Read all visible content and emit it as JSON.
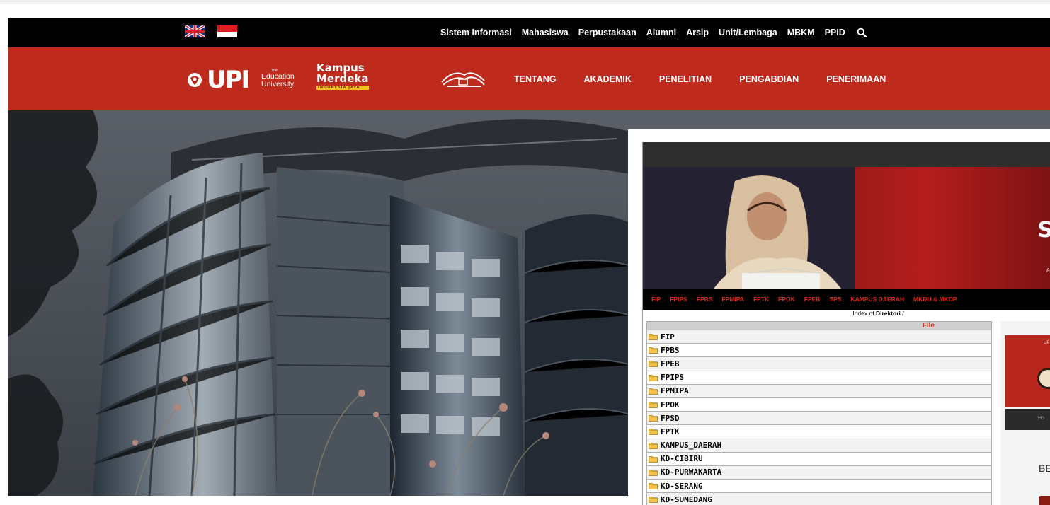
{
  "utility_bar": {
    "flags": [
      {
        "name": "english-flag-icon"
      },
      {
        "name": "indonesian-flag-icon"
      }
    ],
    "links": [
      "Sistem Informasi",
      "Mahasiswa",
      "Perpustakaan",
      "Alumni",
      "Arsip",
      "Unit/Lembaga",
      "MBKM",
      "PPID"
    ],
    "search_icon": "search-icon",
    "background": "#000000"
  },
  "main_nav": {
    "background": "#be2a1c",
    "logo": {
      "wordmark": "UPI",
      "sub_the": "The",
      "sub_line1": "Education",
      "sub_line2": "University"
    },
    "campaign_logo": {
      "line1": "Kampus",
      "line2": "Merdeka",
      "tag": "INDONESIA JAYA"
    },
    "links": [
      "TENTANG",
      "AKADEMIK",
      "PENELITIAN",
      "PENGABDIAN",
      "PENERIMAAN"
    ]
  },
  "directory_page": {
    "faculty_nav": [
      "FIP",
      "FPIPS",
      "FPBS",
      "FPMIPA",
      "FPTK",
      "FPOK",
      "FPEB",
      "SPS",
      "KAMPUS DAERAH",
      "MKDU & MKDP"
    ],
    "index_prefix": "Index of",
    "index_dir": "Direktori",
    "index_suffix": "/",
    "column_header": "File",
    "entries": [
      "FIP",
      "FPBS",
      "FPEB",
      "FPIPS",
      "FPMIPA",
      "FPOK",
      "FPSD",
      "FPTK",
      "KAMPUS_DAERAH",
      "KD-CIBIRU",
      "KD-PURWAKARTA",
      "KD-SERANG",
      "KD-SUMEDANG"
    ],
    "banner_letter": "S",
    "banner_small": "A",
    "side_label": "UP",
    "side_dark_label": "Ho",
    "side_text": "BE",
    "accent": "#d8281c"
  }
}
